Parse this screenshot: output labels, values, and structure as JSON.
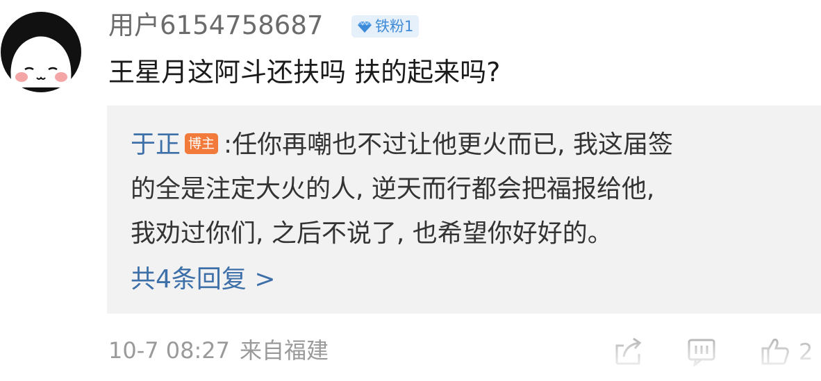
{
  "comment": {
    "username": "用户6154758687",
    "fan_badge": {
      "icon": "diamond-icon",
      "label": "铁粉1",
      "color": "#3d8bd8"
    },
    "text": "王星月这阿斗还扶吗 扶的起来吗?",
    "meta": {
      "date": "10-7 08:27",
      "location": "来自福建"
    },
    "actions": {
      "share_icon": "share-icon",
      "comment_icon": "comment-icon",
      "like_icon": "like-icon",
      "like_count": "2"
    }
  },
  "reply": {
    "author": "于正",
    "author_badge": "博主",
    "separator": ":",
    "line1": "任你再嘲也不过让他更火而已, 我这届签",
    "line2": "的全是注定大火的人, 逆天而行都会把福报给他,",
    "line3": "我劝过你们, 之后不说了, 也希望你好好的。",
    "more": "共4条回复 >"
  },
  "colors": {
    "link": "#3d6fa8",
    "badge_orange": "#f27a3a",
    "reply_bg": "#f2f2f2",
    "meta_gray": "#9a9a9a"
  }
}
